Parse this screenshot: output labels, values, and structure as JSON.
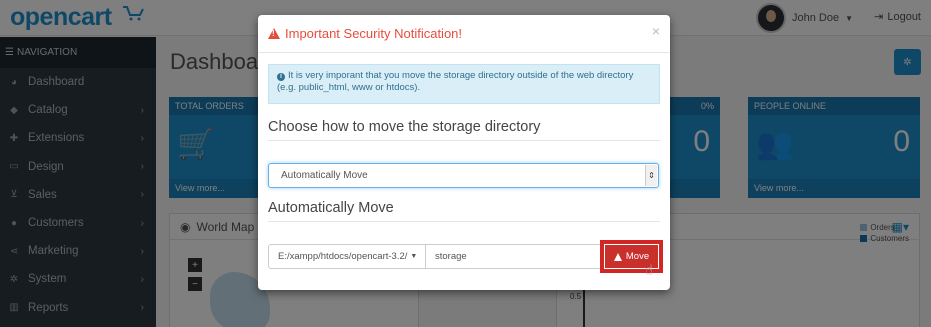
{
  "header": {
    "logo": "opencart",
    "user_name": "John Doe",
    "logout_label": "Logout"
  },
  "sidebar": {
    "title": "NAVIGATION",
    "items": [
      {
        "label": "Dashboard",
        "icon": "dashboard-icon"
      },
      {
        "label": "Catalog",
        "icon": "tag-icon"
      },
      {
        "label": "Extensions",
        "icon": "puzzle-icon"
      },
      {
        "label": "Design",
        "icon": "monitor-icon"
      },
      {
        "label": "Sales",
        "icon": "cart-icon"
      },
      {
        "label": "Customers",
        "icon": "user-icon"
      },
      {
        "label": "Marketing",
        "icon": "share-icon"
      },
      {
        "label": "System",
        "icon": "gear-icon"
      },
      {
        "label": "Reports",
        "icon": "bar-chart-icon"
      }
    ]
  },
  "dashboard": {
    "title": "Dashboard",
    "tiles": [
      {
        "title": "TOTAL ORDERS",
        "footer": "View more...",
        "value": ""
      },
      {
        "title": "",
        "percent": "0%",
        "value": "0",
        "footer": ""
      },
      {
        "title": "PEOPLE ONLINE",
        "value": "0",
        "footer": "View more..."
      }
    ],
    "world_map_title": "World Map",
    "map_zoom_in": "+",
    "map_zoom_out": "−",
    "chart_legend": [
      "Orders",
      "Customers"
    ],
    "chart_axis_tick": "0.5"
  },
  "modal": {
    "title": "Important Security Notification!",
    "close": "×",
    "alert_text": "It is very imporant that you move the storage directory outside of the web directory (e.g. public_html, www or htdocs).",
    "heading_choose": "Choose how to move the storage directory",
    "select_value": "Automatically Move",
    "heading_auto": "Automatically Move",
    "path_value": "E:/xampp/htdocs/opencart-3.2/",
    "storage_value": "storage",
    "move_label": "Move"
  },
  "colors": {
    "brand": "#1e91cf",
    "danger": "#e84c3d",
    "sidebar_bg": "#2e3942"
  }
}
